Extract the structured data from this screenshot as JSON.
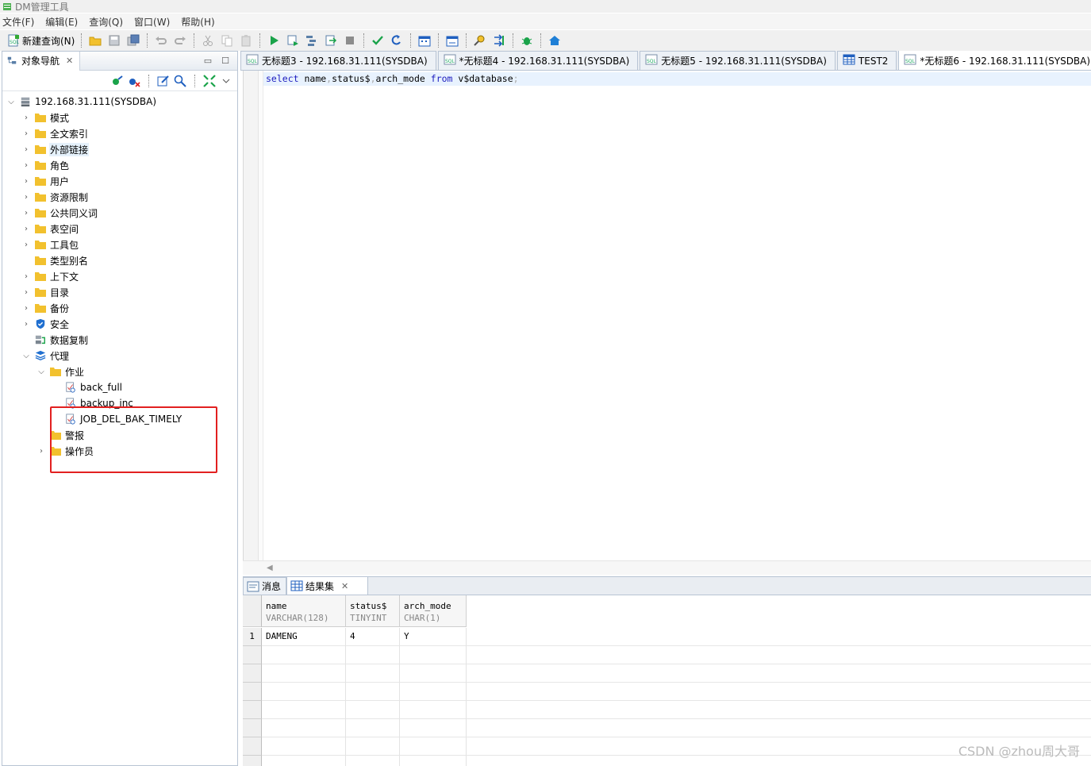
{
  "app": {
    "title": "DM管理工具"
  },
  "menu": [
    "文件(F)",
    "编辑(E)",
    "查询(Q)",
    "窗口(W)",
    "帮助(H)"
  ],
  "toolbar": {
    "new_query_label": "新建查询(N)"
  },
  "navigator": {
    "tab_label": "对象导航",
    "root": "192.168.31.111(SYSDBA)",
    "items": [
      {
        "label": "模式",
        "expander": "collapsed",
        "icon": "folder-icon"
      },
      {
        "label": "全文索引",
        "expander": "collapsed",
        "icon": "folder-icon"
      },
      {
        "label": "外部链接",
        "expander": "collapsed",
        "icon": "folder-icon",
        "selected": true
      },
      {
        "label": "角色",
        "expander": "collapsed",
        "icon": "folder-icon"
      },
      {
        "label": "用户",
        "expander": "collapsed",
        "icon": "folder-icon"
      },
      {
        "label": "资源限制",
        "expander": "collapsed",
        "icon": "folder-icon"
      },
      {
        "label": "公共同义词",
        "expander": "collapsed",
        "icon": "folder-icon"
      },
      {
        "label": "表空间",
        "expander": "collapsed",
        "icon": "folder-icon"
      },
      {
        "label": "工具包",
        "expander": "collapsed",
        "icon": "folder-icon"
      },
      {
        "label": "类型别名",
        "expander": "none",
        "icon": "folder-icon"
      },
      {
        "label": "上下文",
        "expander": "collapsed",
        "icon": "folder-icon"
      },
      {
        "label": "目录",
        "expander": "collapsed",
        "icon": "folder-icon"
      },
      {
        "label": "备份",
        "expander": "collapsed",
        "icon": "folder-icon"
      },
      {
        "label": "安全",
        "expander": "collapsed",
        "icon": "shield-icon"
      },
      {
        "label": "数据复制",
        "expander": "none",
        "icon": "replication-icon"
      },
      {
        "label": "代理",
        "expander": "expanded",
        "icon": "layers-icon"
      }
    ],
    "agent_children": {
      "jobs_label": "作业",
      "jobs": [
        "back_full",
        "backup_inc",
        "JOB_DEL_BAK_TIMELY"
      ],
      "alerts_label": "警报",
      "operators_label": "操作员"
    }
  },
  "editor_tabs": [
    {
      "label": "无标题3 - 192.168.31.111(SYSDBA)",
      "icon": "sql-file-icon",
      "active": false
    },
    {
      "label": "*无标题4 - 192.168.31.111(SYSDBA)",
      "icon": "sql-file-icon",
      "active": false
    },
    {
      "label": "无标题5 - 192.168.31.111(SYSDBA)",
      "icon": "sql-file-icon",
      "active": false
    },
    {
      "label": "TEST2",
      "icon": "table-icon",
      "active": false
    },
    {
      "label": "*无标题6 - 192.168.31.111(SYSDBA)",
      "icon": "sql-file-icon",
      "active": true
    }
  ],
  "editor": {
    "sql_tokens": [
      {
        "t": "select",
        "c": "kw"
      },
      {
        "t": " name",
        "c": "id"
      },
      {
        "t": ",",
        "c": "punc"
      },
      {
        "t": "status$",
        "c": "id"
      },
      {
        "t": ",",
        "c": "punc"
      },
      {
        "t": "arch_mode ",
        "c": "id"
      },
      {
        "t": "from",
        "c": "kw"
      },
      {
        "t": " v$database",
        "c": "id"
      },
      {
        "t": ";",
        "c": "punc"
      }
    ]
  },
  "results": {
    "tabs": [
      {
        "label": "消息",
        "icon": "message-icon"
      },
      {
        "label": "结果集",
        "icon": "grid-icon",
        "active": true
      }
    ],
    "columns": [
      {
        "name": "name",
        "type": "VARCHAR(128)"
      },
      {
        "name": "status$",
        "type": "TINYINT"
      },
      {
        "name": "arch_mode",
        "type": "CHAR(1)"
      }
    ],
    "rows": [
      [
        "DAMENG",
        "4",
        "Y"
      ]
    ],
    "row_numbers": [
      "1"
    ]
  },
  "watermark": "CSDN @zhou周大哥",
  "colors": {
    "highlight_box": "#e22020",
    "folder": "#f2c12e",
    "keyword": "#1c1cbf"
  }
}
